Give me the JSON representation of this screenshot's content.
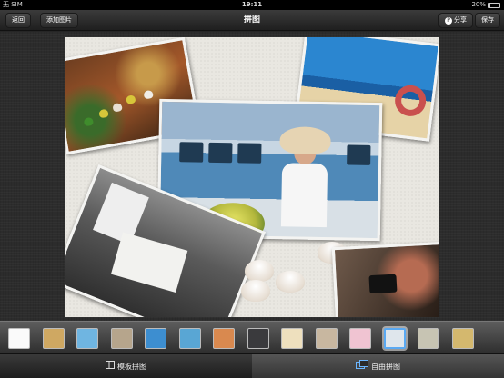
{
  "status_bar": {
    "carrier": "无 SIM",
    "time": "19:11",
    "battery": "20%",
    "battery_level": 0.2
  },
  "nav": {
    "back_label": "返回",
    "add_image_label": "添加图片",
    "title": "拼图",
    "share_label": "分享",
    "save_label": "保存"
  },
  "background_swatches": [
    {
      "name": "white",
      "color": "#fafafa"
    },
    {
      "name": "sand",
      "color": "#cfa862"
    },
    {
      "name": "sky",
      "color": "#6fb5e1"
    },
    {
      "name": "stone",
      "color": "#b6a58c"
    },
    {
      "name": "ocean",
      "color": "#3d8ed0"
    },
    {
      "name": "beach",
      "color": "#59a6d4"
    },
    {
      "name": "stripes",
      "color": "#d9894f"
    },
    {
      "name": "dark",
      "color": "#3a3a3d"
    },
    {
      "name": "cream",
      "color": "#eee0be"
    },
    {
      "name": "floral",
      "color": "#c8b7a0"
    },
    {
      "name": "pink",
      "color": "#f0c4d2"
    },
    {
      "name": "starfish",
      "color": "#dfe6ec",
      "selected": true
    },
    {
      "name": "wood",
      "color": "#c7c4b3"
    },
    {
      "name": "dunes",
      "color": "#d4b86e"
    }
  ],
  "tabs": [
    {
      "label": "模板拼图",
      "active": false
    },
    {
      "label": "自由拼图",
      "active": true
    }
  ]
}
